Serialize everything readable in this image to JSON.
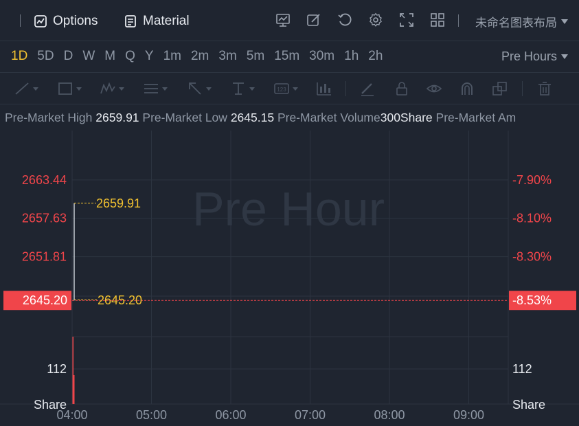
{
  "header": {
    "options_label": "Options",
    "material_label": "Material",
    "layout_label": "未命名图表布局"
  },
  "periods": [
    "1D",
    "5D",
    "D",
    "W",
    "M",
    "Q",
    "Y",
    "1m",
    "2m",
    "3m",
    "5m",
    "15m",
    "30m",
    "1h",
    "2h"
  ],
  "active_period": "1D",
  "session_selector": "Pre Hours",
  "info": {
    "high_label": "Pre-Market High",
    "high_value": "2659.91",
    "low_label": "Pre-Market Low",
    "low_value": "2645.15",
    "volume_label": "Pre-Market Volume",
    "volume_value": "300Share",
    "amount_label": "Pre-Market Am"
  },
  "colors": {
    "accent": "#f2c230",
    "down": "#f0454a",
    "bg": "#1f2530",
    "grid": "#2c3440"
  },
  "chart_data": {
    "type": "line",
    "watermark": "Pre Hour",
    "x_ticks": [
      "04:00",
      "05:00",
      "06:00",
      "07:00",
      "08:00",
      "09:00"
    ],
    "price_ticks": [
      "2663.44",
      "2657.63",
      "2651.81"
    ],
    "percent_ticks": [
      "-7.90%",
      "-8.10%",
      "-8.30%"
    ],
    "price_range": [
      2642,
      2668
    ],
    "points": [
      {
        "x": "04:00",
        "y": 2657.5
      },
      {
        "x": "04:00",
        "y": 2659.91
      },
      {
        "x": "04:00",
        "y": 2645.2
      }
    ],
    "high_marker": "2659.91",
    "last_marker": "2645.20",
    "current_price": "2645.20",
    "current_percent": "-8.53%",
    "volume_tick": "112",
    "volume_unit": "Share",
    "volume_max": 140,
    "volume_bars": [
      140,
      60
    ]
  }
}
